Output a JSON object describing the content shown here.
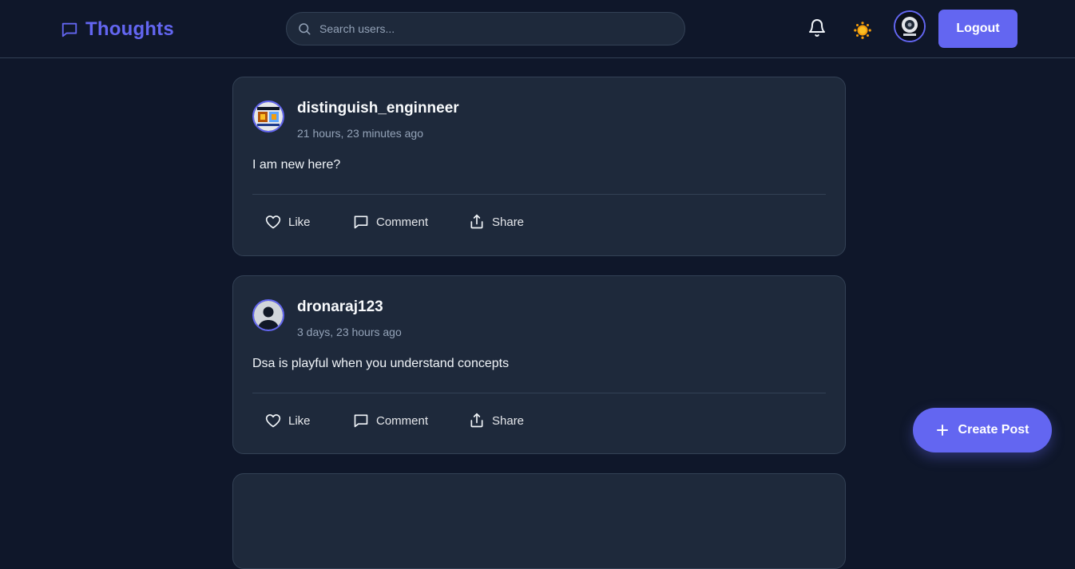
{
  "app": {
    "brand": "Thoughts",
    "accent_color": "#6366f1",
    "background_color": "#0f172a",
    "card_color": "#1e293b"
  },
  "header": {
    "search_placeholder": "Search users...",
    "bell_icon": "bell-icon",
    "theme_icon": "sun-icon",
    "logout_label": "Logout"
  },
  "posts": [
    {
      "username": "distinguish_enginneer",
      "timestamp": "21 hours, 23 minutes ago",
      "content": "I am new here?",
      "avatar": "photo-avatar"
    },
    {
      "username": "dronaraj123",
      "timestamp": "3 days, 23 hours ago",
      "content": "Dsa is playful when you understand concepts",
      "avatar": "default-avatar"
    }
  ],
  "actions": {
    "like": "Like",
    "comment": "Comment",
    "share": "Share"
  },
  "fab": {
    "label": "Create Post"
  }
}
